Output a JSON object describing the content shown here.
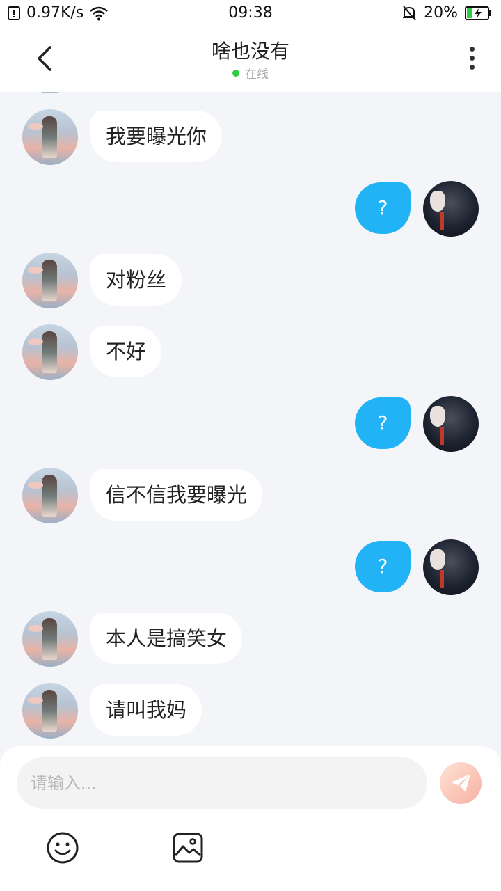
{
  "status_bar": {
    "speed": "0.97K/s",
    "time": "09:38",
    "battery": "20%"
  },
  "header": {
    "title": "啥也没有",
    "status": "在线"
  },
  "messages": [
    {
      "from": "her",
      "text": "我要曝光你"
    },
    {
      "from": "me",
      "text": "?"
    },
    {
      "from": "her",
      "text": "对粉丝"
    },
    {
      "from": "her",
      "text": "不好"
    },
    {
      "from": "me",
      "text": "?"
    },
    {
      "from": "her",
      "text": "信不信我要曝光"
    },
    {
      "from": "me",
      "text": "?"
    },
    {
      "from": "her",
      "text": "本人是搞笑女"
    },
    {
      "from": "her",
      "text": "请叫我妈"
    }
  ],
  "input": {
    "placeholder": "请输入..."
  },
  "icons": {
    "back": "chevron-left-icon",
    "more": "more-vertical-icon",
    "send": "paper-plane-icon",
    "emoji": "smiley-icon",
    "image": "image-icon"
  },
  "colors": {
    "my_bubble": "#22b2f6",
    "online_dot": "#2ecc40",
    "send_button": "#f7b0a2"
  }
}
